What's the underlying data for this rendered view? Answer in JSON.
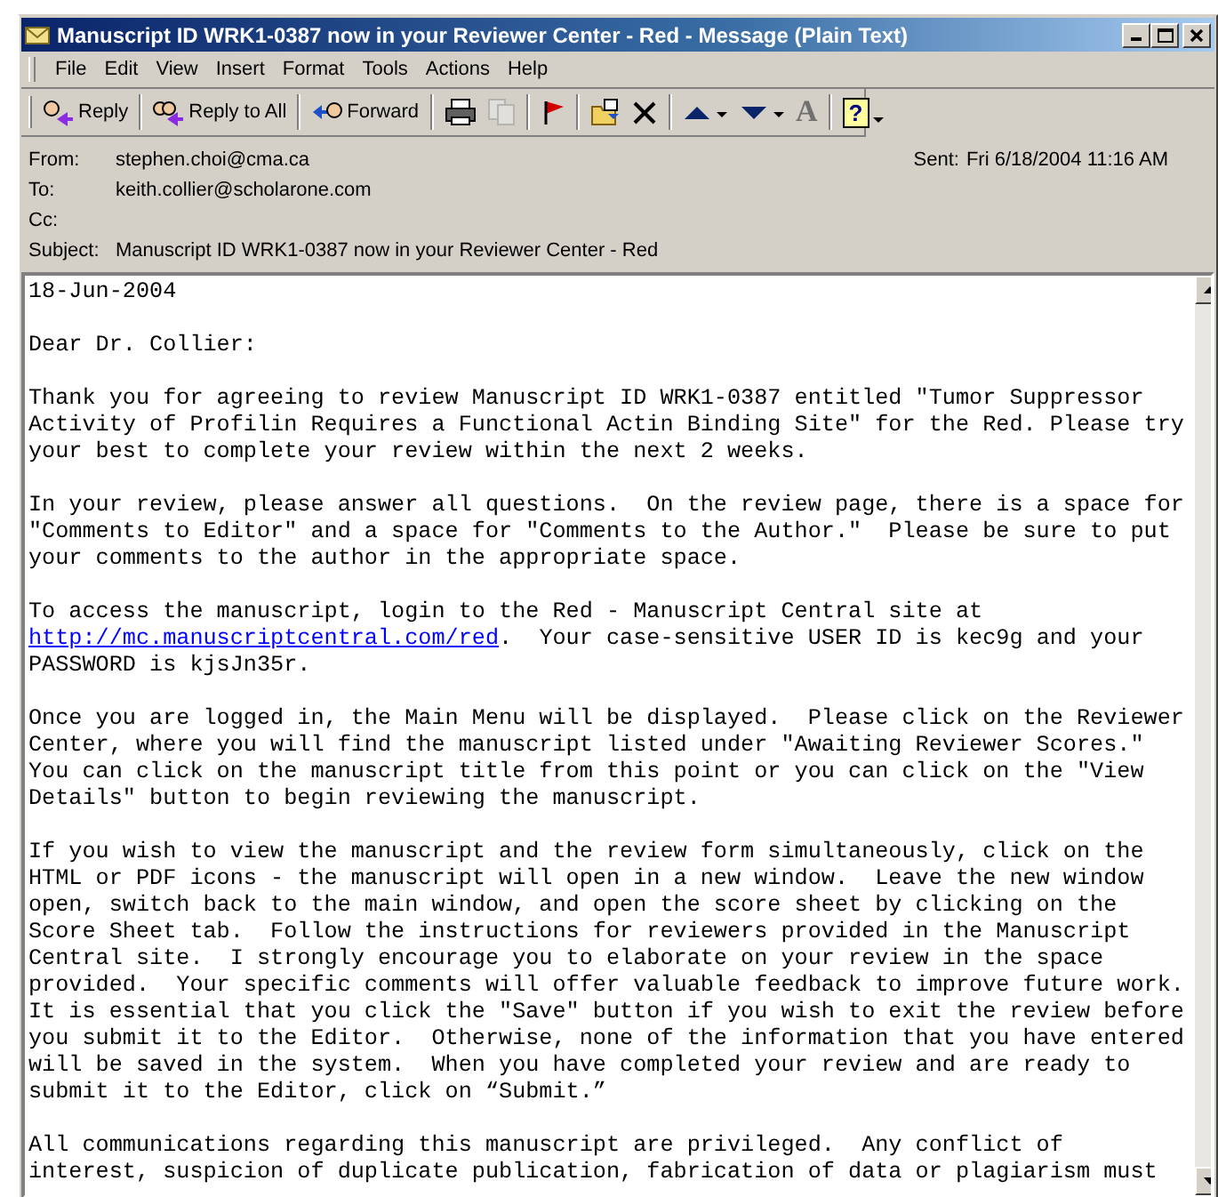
{
  "window": {
    "title": "Manuscript ID WRK1-0387 now in your Reviewer Center - Red - Message (Plain Text)"
  },
  "menu": [
    {
      "label": "File"
    },
    {
      "label": "Edit"
    },
    {
      "label": "View"
    },
    {
      "label": "Insert"
    },
    {
      "label": "Format"
    },
    {
      "label": "Tools"
    },
    {
      "label": "Actions"
    },
    {
      "label": "Help"
    }
  ],
  "toolbar": [
    [
      {
        "kind": "reply",
        "label": "Reply",
        "disabled": false
      }
    ],
    [
      {
        "kind": "reply_all",
        "label": "Reply to All",
        "disabled": false
      }
    ],
    [
      {
        "kind": "forward",
        "label": "Forward",
        "disabled": false
      }
    ],
    [
      {
        "kind": "print",
        "disabled": false
      },
      {
        "kind": "copy",
        "disabled": true
      }
    ],
    [
      {
        "kind": "flag",
        "disabled": false
      }
    ],
    [
      {
        "kind": "move",
        "disabled": false
      },
      {
        "kind": "delete",
        "disabled": false
      }
    ],
    [
      {
        "kind": "previous",
        "disabled": false
      },
      {
        "kind": "next",
        "disabled": false
      },
      {
        "kind": "font",
        "label": "A",
        "disabled": true
      }
    ],
    [
      {
        "kind": "help",
        "label": "?",
        "disabled": false
      }
    ]
  ],
  "header": {
    "fields": [
      {
        "label": "From:",
        "value": "stephen.choi@cma.ca"
      },
      {
        "label": "To:",
        "value": "keith.collier@scholarone.com"
      },
      {
        "label": "Cc:"
      },
      {
        "label": "Subject:",
        "value": "Manuscript ID WRK1-0387 now in your Reviewer Center - Red"
      }
    ],
    "sent": {
      "label": "Sent:",
      "value": "Fri 6/18/2004 11:16 AM"
    }
  },
  "body": [
    [
      {
        "kind": "text",
        "text": "18-Jun-2004"
      }
    ],
    [
      {
        "kind": "text",
        "text": "Dear Dr. Collier:"
      }
    ],
    [
      {
        "kind": "text",
        "text": "Thank you for agreeing to review Manuscript ID WRK1-0387 entitled \"Tumor Suppressor\nActivity of Profilin Requires a Functional Actin Binding Site\" for the Red. Please try\nyour best to complete your review within the next 2 weeks."
      }
    ],
    [
      {
        "kind": "text",
        "text": "In your review, please answer all questions.  On the review page, there is a space for\n\"Comments to Editor\" and a space for \"Comments to the Author.\"  Please be sure to put\nyour comments to the author in the appropriate space."
      }
    ],
    [
      {
        "kind": "text",
        "text": "To access the manuscript, login to the Red - Manuscript Central site at\n"
      },
      {
        "kind": "link",
        "text": "http://mc.manuscriptcentral.com/red"
      },
      {
        "kind": "text",
        "text": ".  Your case-sensitive USER ID is kec9g and your\nPASSWORD is kjsJn35r."
      }
    ],
    [
      {
        "kind": "text",
        "text": "Once you are logged in, the Main Menu will be displayed.  Please click on the Reviewer\nCenter, where you will find the manuscript listed under \"Awaiting Reviewer Scores.\"\nYou can click on the manuscript title from this point or you can click on the \"View\nDetails\" button to begin reviewing the manuscript."
      }
    ],
    [
      {
        "kind": "text",
        "text": "If you wish to view the manuscript and the review form simultaneously, click on the\nHTML or PDF icons - the manuscript will open in a new window.  Leave the new window\nopen, switch back to the main window, and open the score sheet by clicking on the\nScore Sheet tab.  Follow the instructions for reviewers provided in the Manuscript\nCentral site.  I strongly encourage you to elaborate on your review in the space\nprovided.  Your specific comments will offer valuable feedback to improve future work.\nIt is essential that you click the \"Save\" button if you wish to exit the review before\nyou submit it to the Editor.  Otherwise, none of the information that you have entered\nwill be saved in the system.  When you have completed your review and are ready to\nsubmit it to the Editor, click on “Submit.”"
      }
    ],
    [
      {
        "kind": "text",
        "text": "All communications regarding this manuscript are privileged.  Any conflict of\ninterest, suspicion of duplicate publication, fabrication of data or plagiarism must"
      }
    ]
  ]
}
